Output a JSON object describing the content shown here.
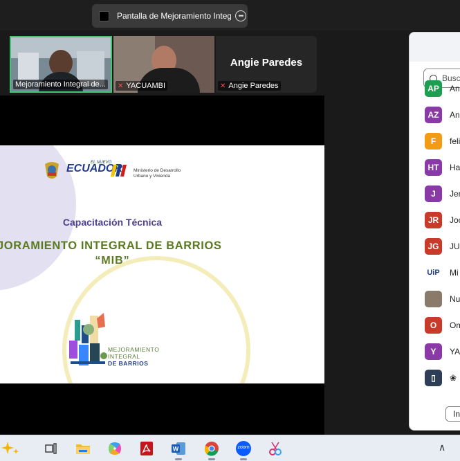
{
  "share_bar": {
    "title": "Pantalla de Mejoramiento Integral"
  },
  "participants_video": [
    {
      "name": "Mejoramiento Integral de..."
    },
    {
      "name": "YACUAMBI"
    },
    {
      "name": "Angie Paredes",
      "big_name": "Angie Paredes"
    }
  ],
  "slide": {
    "brand": "ECUADOR",
    "brand_small": "EL NUEVO",
    "ministry_line1": "Ministerio de Desarrollo",
    "ministry_line2": "Urbano y Vivienda",
    "subtitle": "Capacitación Técnica",
    "title": "JORAMIENTO INTEGRAL DE BARRIOS",
    "acronym": "“MIB”",
    "logo_line1": "MEJORAMIENTO",
    "logo_line2": "INTEGRAL",
    "logo_line3": "DE BARRIOS"
  },
  "panel": {
    "search_placeholder": "Busca",
    "participants": [
      {
        "initials": "AP",
        "name": "An",
        "color": "#1e9e50"
      },
      {
        "initials": "AZ",
        "name": "An",
        "color": "#8a3aa6"
      },
      {
        "initials": "F",
        "name": "feli",
        "color": "#f29b14"
      },
      {
        "initials": "HT",
        "name": "Ha",
        "color": "#8a3aa6"
      },
      {
        "initials": "J",
        "name": "Jen",
        "color": "#8a3aa6"
      },
      {
        "initials": "JR",
        "name": "Joc",
        "color": "#c83a2a"
      },
      {
        "initials": "JG",
        "name": "JUA",
        "color": "#c83a2a"
      },
      {
        "initials": "UiP",
        "name": "Mi",
        "color": "#ffffff"
      },
      {
        "initials": "",
        "name": "Nu",
        "color": "#8a7a6a"
      },
      {
        "initials": "O",
        "name": "Om",
        "color": "#c83a2a"
      },
      {
        "initials": "Y",
        "name": "YAC",
        "color": "#8a3aa6"
      },
      {
        "initials": "▯",
        "name": "❀",
        "color": "#2d3e56"
      }
    ],
    "invite_label": "Inv"
  },
  "taskbar": {
    "zoom_label": "zoom",
    "chevron": "∧"
  }
}
